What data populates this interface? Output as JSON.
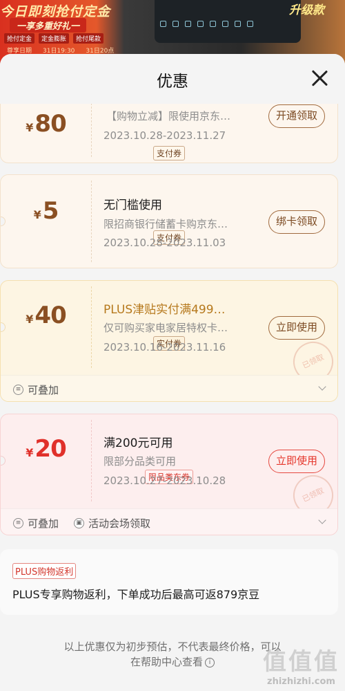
{
  "banner": {
    "title": "今日即刻抢付定金",
    "subtitle": "一享多重好礼一",
    "chips": [
      "抢付定金",
      "定金膨胀",
      "抢付尾款"
    ],
    "chips_dates": [
      "尊享日期",
      "31日19:30",
      "31日20点"
    ],
    "badge": "升级款"
  },
  "sheet": {
    "title": "优惠"
  },
  "coupons": [
    {
      "amount": "80",
      "currency": "¥",
      "tag": "支付券",
      "title": "",
      "desc": "【购物立减】限使用京东…",
      "date": "2023.10.28-2023.11.27",
      "button": "开通领取"
    },
    {
      "amount": "5",
      "currency": "¥",
      "tag": "支付券",
      "title": "无门槛使用",
      "desc": "限招商银行储蓄卡购京东…",
      "date": "2023.10.28-2023.11.03",
      "button": "绑卡领取"
    },
    {
      "amount": "40",
      "currency": "¥",
      "tag": "实付券",
      "title": "PLUS津贴实付满499…",
      "desc": "仅可购买家电家居特权卡…",
      "date": "2023.10.16-2023.11.16",
      "button": "立即使用",
      "stamp": "已领取",
      "foot": [
        "可叠加"
      ]
    },
    {
      "amount": "20",
      "currency": "¥",
      "tag": "限品类东券",
      "title": "满200元可用",
      "desc": "限部分品类可用",
      "date": "2023.10.27-2023.10.28",
      "button": "立即使用",
      "stamp": "已领取",
      "foot": [
        "可叠加",
        "活动会场领取"
      ]
    }
  ],
  "plus": {
    "tag": "PLUS购物返利",
    "text": "PLUS专享购物返利，下单成功后最高可返879京豆"
  },
  "note": {
    "line1": "以上优惠仅为初步预估，不代表最终价格，可以",
    "line2": "在帮助中心查看"
  },
  "watermark": {
    "logo": "值值值",
    "text": "zhizhizhi.com"
  },
  "colors": {
    "brown": "#8a4f22",
    "red": "#e5352a",
    "gold": "#b6791d"
  }
}
